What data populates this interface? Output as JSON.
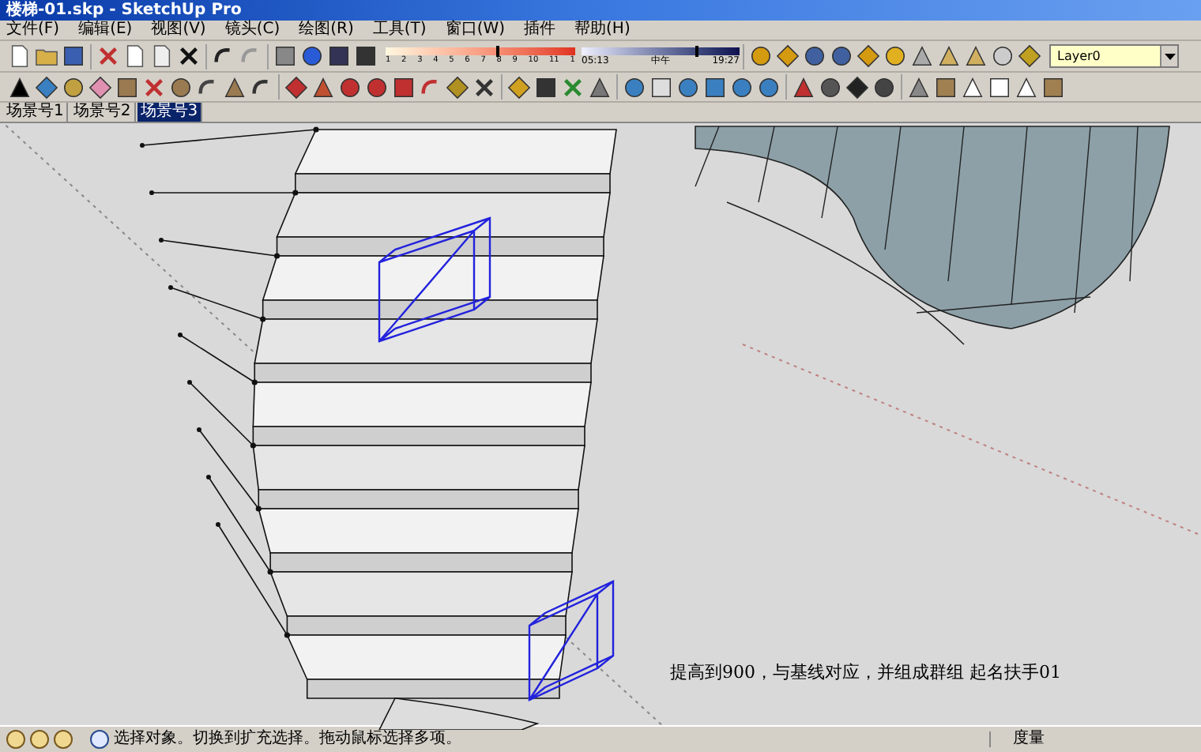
{
  "window": {
    "title": "楼梯-01.skp - SketchUp Pro"
  },
  "menu": [
    "文件(F)",
    "编辑(E)",
    "视图(V)",
    "镜头(C)",
    "绘图(R)",
    "工具(T)",
    "窗口(W)",
    "插件",
    "帮助(H)"
  ],
  "shadow": {
    "months": [
      "1",
      "2",
      "3",
      "4",
      "5",
      "6",
      "7",
      "8",
      "9",
      "10",
      "11",
      "1"
    ],
    "month_slider": {
      "level": 0.58
    },
    "time_start": "05:13",
    "time_mid": "中午",
    "time_end": "19:27",
    "time_slider": {
      "level": 0.72
    }
  },
  "layer": {
    "value": "Layer0"
  },
  "scenes": [
    {
      "label": "场景号1",
      "selected": false
    },
    {
      "label": "场景号2",
      "selected": false
    },
    {
      "label": "场景号3",
      "selected": true
    }
  ],
  "caption": "提高到900，与基线对应，并组成群组 起名扶手01",
  "status_bar": {
    "message": "选择对象。切换到扩充选择。拖动鼠标选择多项。",
    "measure_label": "度量"
  }
}
